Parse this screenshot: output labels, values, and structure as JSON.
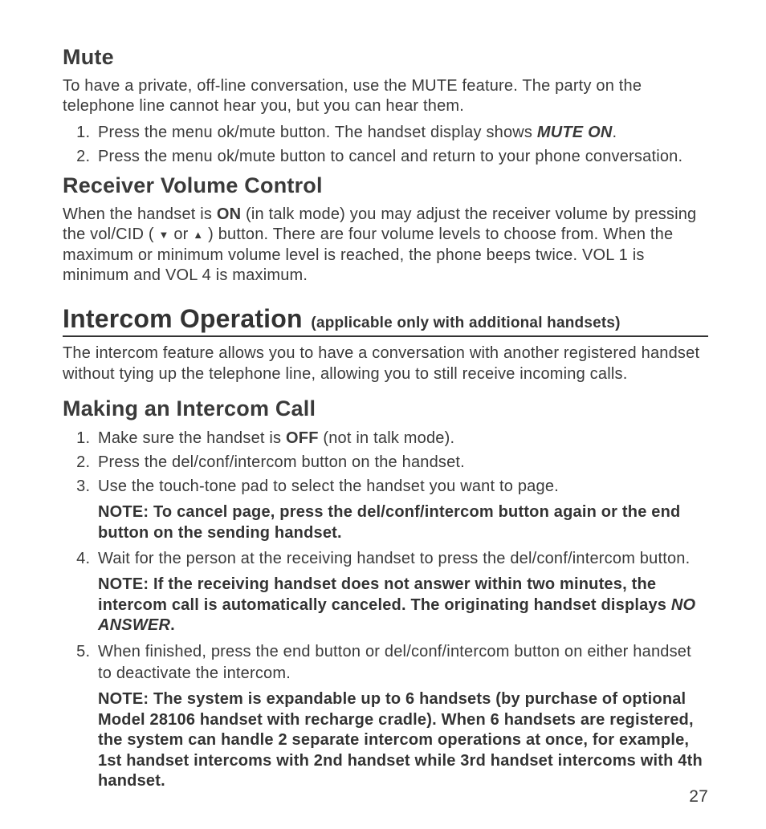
{
  "mute": {
    "heading": "Mute",
    "intro": "To have a private, off-line conversation, use the MUTE feature. The party on the telephone line cannot hear you, but you can hear them.",
    "step1_a": "Press the menu ok/mute button. The handset display shows ",
    "step1_b": "MUTE ON",
    "step1_c": ".",
    "step2": "Press the menu ok/mute button to cancel and return to your phone conversation."
  },
  "rvc": {
    "heading": "Receiver Volume Control",
    "p1_a": "When the handset is ",
    "p1_b": "ON",
    "p1_c": " (in talk mode) you may adjust the receiver volume by pressing the vol/CID ( ",
    "arrow_down": "▼",
    "p1_d": " or ",
    "arrow_up": "▲",
    "p1_e": " ) button. There are four volume levels to choose from. When the maximum or minimum volume level is reached, the phone beeps twice. VOL 1 is minimum and VOL 4 is maximum."
  },
  "intercom": {
    "heading": "Intercom Operation",
    "heading_sub": "(applicable only with additional handsets)",
    "intro": "The intercom feature allows you to have a conversation with another registered handset without tying up the telephone line, allowing you to still receive incoming calls."
  },
  "making": {
    "heading": "Making an Intercom Call",
    "s1_a": "Make sure the handset is ",
    "s1_b": "OFF",
    "s1_c": " (not in talk mode).",
    "s2": "Press the del/conf/intercom button on the handset.",
    "s3": "Use the touch-tone pad to select the handset you want to page.",
    "note1": "NOTE: To cancel page, press the del/conf/intercom button again or the end button on the sending handset.",
    "s4": "Wait for the person at the receiving handset to press the del/conf/intercom button.",
    "note2_a": "NOTE: If the receiving handset does not answer within two minutes, the intercom call is automatically canceled. The originating handset displays ",
    "note2_b": "NO ANSWER",
    "note2_c": ".",
    "s5": "When finished, press the end button or del/conf/intercom button on either handset to deactivate the intercom.",
    "note3": "NOTE: The system is expandable up to 6 handsets (by purchase of optional Model 28106 handset with recharge cradle). When 6 handsets are registered, the system can handle 2 separate intercom operations at once, for example, 1st handset intercoms with 2nd handset while 3rd handset intercoms with 4th handset."
  },
  "page_number": "27"
}
